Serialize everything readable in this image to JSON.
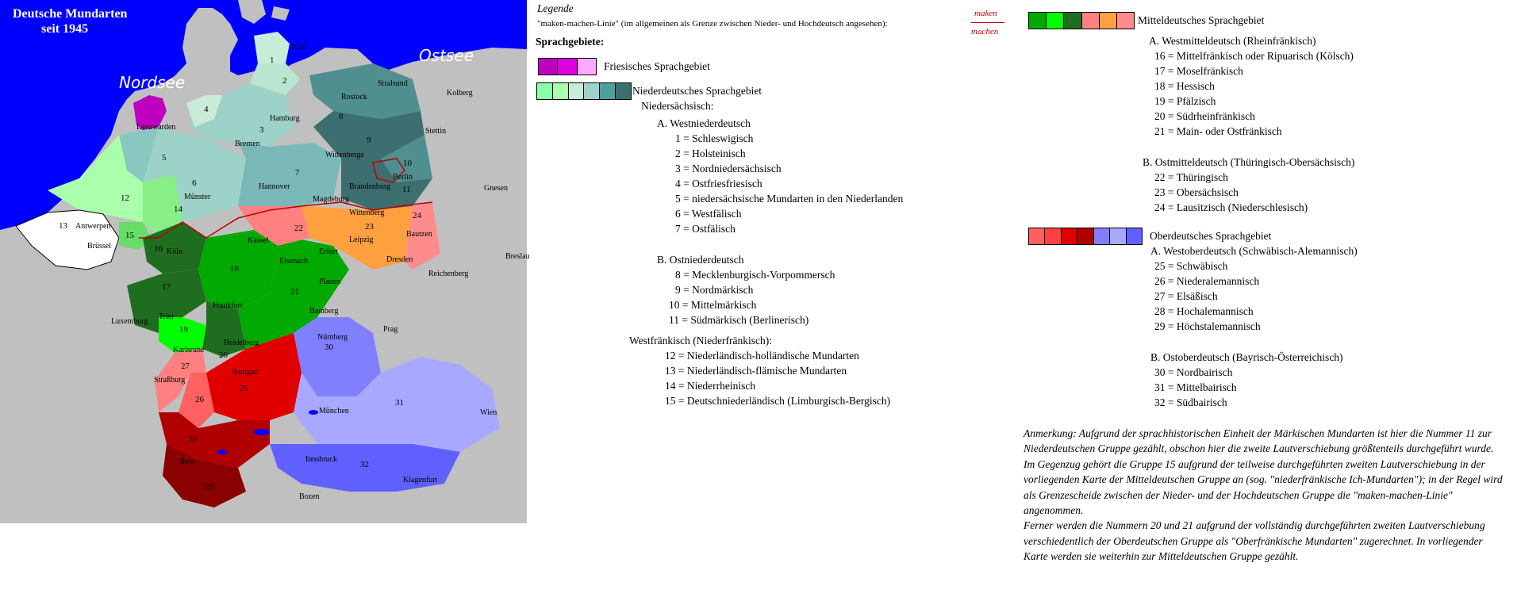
{
  "map": {
    "title_line1": "Deutsche Mundarten",
    "title_line2": "seit 1945",
    "seas": {
      "nordsee": "Nordsee",
      "ostsee": "Ostsee"
    },
    "colors": {
      "sea": "#0000ff",
      "land": "#c0c0c0",
      "friesisch": "#c000c0",
      "nd1": "#c8ecd8",
      "nd2": "#b8e6d0",
      "nd3": "#9cd2c8",
      "nd4": "#7ab8b8",
      "nd5": "#4f8f90",
      "nd6": "#3d6e70",
      "nl1": "#aaffaa",
      "nl2": "#88ee88",
      "nl3": "#66dd66",
      "wmd1": "#1f6e1f",
      "wmd2": "#00aa00",
      "wmd3": "#00ff00",
      "omd1": "#ff8080",
      "omd2": "#ffa040",
      "omd3": "#ff8c8c",
      "od1": "#e00000",
      "od2": "#ff6060",
      "od3": "#b00000",
      "od4": "#8080ff",
      "od5": "#a8a8ff",
      "od6": "#6060ff"
    },
    "cities": [
      "Kiel",
      "Stralsund",
      "Kolberg",
      "Rostock",
      "Leeuwarden",
      "Hamburg",
      "Bremen",
      "Stettin",
      "Wittenberge",
      "Berlin",
      "Hannover",
      "Brandenburg",
      "Gnesen",
      "Münster",
      "Magdeburg",
      "Wittenberg",
      "Antwerpen",
      "Brüssel",
      "Kassel",
      "Leipzig",
      "Bautzen",
      "Köln",
      "Erfurt",
      "Eisenach",
      "Dresden",
      "Breslau",
      "Plauen",
      "Reichenberg",
      "Trier",
      "Frankfurt",
      "Luxemburg",
      "Bamberg",
      "Prag",
      "Karlsruhe",
      "Heidelberg",
      "Nürnberg",
      "Straßburg",
      "Stuttgart",
      "München",
      "Wien",
      "Bern",
      "Innsbruck",
      "Klagenfurt",
      "Bozen"
    ],
    "numbers": [
      "1",
      "2",
      "3",
      "4",
      "5",
      "6",
      "7",
      "8",
      "9",
      "10",
      "11",
      "12",
      "13",
      "14",
      "15",
      "16",
      "17",
      "18",
      "19",
      "20",
      "21",
      "22",
      "23",
      "24",
      "25",
      "26",
      "27",
      "28",
      "29",
      "30",
      "31",
      "32"
    ]
  },
  "legend": {
    "heading": "Legende",
    "maken_line": "\"maken-machen-Linie\" (im allgemeinen als Grenze zwischen Nieder- und Hochdeutsch angesehen):",
    "maken": "maken",
    "machen": "machen",
    "sprachgebiete": "Sprachgebiete:",
    "friesisch": "Friesisches Sprachgebiet",
    "niederdeutsch": "Niederdeutsches Sprachgebiet",
    "niedersaechsisch": "Niedersächsisch:",
    "westniederdeutsch": "A.  Westniederdeutsch",
    "nd_items": [
      "1  = Schleswigisch",
      "2  = Holsteinisch",
      "3  = Nordniedersächsisch",
      "4  = Ostfriesfriesisch",
      "5  = niedersächsische Mundarten in den Niederlanden",
      "6  = Westfälisch",
      "7  = Ostfälisch"
    ],
    "ostniederdeutsch": "B.  Ostniederdeutsch",
    "ond_items": [
      "8 = Mecklenburgisch-Vorpommersch",
      "9 = Nordmärkisch",
      "10 = Mittelmärkisch",
      "11 = Südmärkisch (Berlinerisch)"
    ],
    "westfraenkisch": "Westfränkisch (Niederfränkisch):",
    "wf_items": [
      "12 = Niederländisch-holländische Mundarten",
      "13 = Niederländisch-flämische Mundarten",
      "14 = Niederrheinisch",
      "15 = Deutschniederländisch (Limburgisch-Bergisch)"
    ],
    "mitteldeutsch": "Mitteldeutsches Sprachgebiet",
    "westmitteldeutsch": "A.  Westmitteldeutsch (Rheinfränkisch)",
    "wmd_items": [
      "16 = Mittelfränkisch oder Ripuarisch (Kölsch)",
      "17 = Moselfränkisch",
      "18 = Hessisch",
      "19 = Pfälzisch",
      "20 = Südrheinfränkisch",
      "21 = Main- oder Ostfränkisch"
    ],
    "ostmitteldeutsch": "B.  Ostmitteldeutsch (Thüringisch-Obersächsisch)",
    "omd_items": [
      "22 = Thüringisch",
      "23 = Obersächsisch",
      "24 = Lausitzisch (Niederschlesisch)"
    ],
    "oberdeutsch": "Oberdeutsches Sprachgebiet",
    "westoberdeutsch": "A.  Westoberdeutsch (Schwäbisch-Alemannisch)",
    "wod_items": [
      "25 = Schwäbisch",
      "26 = Niederalemannisch",
      "27 = Elsäßisch",
      "28 = Hochalemannisch",
      "29 = Höchstalemannisch"
    ],
    "ostoberdeutsch": "B.  Ostoberdeutsch (Bayrisch-Österreichisch)",
    "ood_items": [
      "30 = Nordbairisch",
      "31 = Mittelbairisch",
      "32 = Südbairisch"
    ],
    "swatches": {
      "friesisch": [
        "#c000c0",
        "#e000e0",
        "#ffaaff"
      ],
      "niederdeutsch": [
        "#88ffaa",
        "#aaffaa",
        "#c8ecd8",
        "#9cd2c8",
        "#4f9f9f",
        "#3d6e70"
      ],
      "mitteldeutsch": [
        "#00aa00",
        "#00ff00",
        "#1f6e1f",
        "#ff8080",
        "#ffa040",
        "#ff8c8c"
      ],
      "oberdeutsch": [
        "#ff6060",
        "#ff4040",
        "#e00000",
        "#b00000",
        "#8080ff",
        "#a8a8ff",
        "#6060ff"
      ]
    }
  },
  "note": {
    "p1": "Anmerkung: Aufgrund der sprachhistorischen Einheit der Märkischen Mundarten ist hier die Nummer 11 zur Niederdeutschen Gruppe gezählt, obschon hier die zweite Lautverschiebung größtenteils durchgeführt wurde. Im Gegenzug gehört die Gruppe 15 aufgrund der teilweise durchgeführten zweiten Lautverschiebung in der vorliegenden Karte der Mitteldeutschen Gruppe an (sog. \"niederfränkische Ich-Mundarten\"); in der Regel wird als Grenzescheide zwischen der Nieder- und der Hochdeutschen Gruppe die \"maken-machen-Linie\" angenommen.",
    "p2": "Ferner werden die Nummern 20 und 21 aufgrund der vollständig durchgeführten zweiten Lautverschiebung verschiedentlich der Oberdeutschen Gruppe als \"Oberfränkische Mundarten\" zugerechnet. In vorliegender Karte werden sie weiterhin zur Mitteldeutschen Gruppe gezählt."
  }
}
